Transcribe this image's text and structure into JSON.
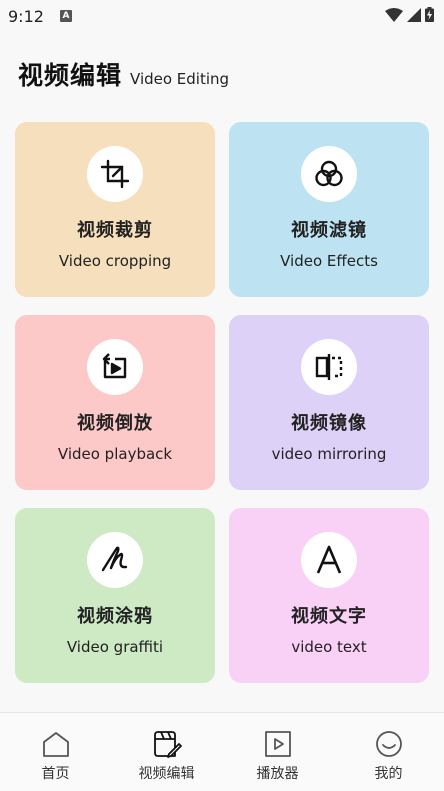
{
  "status": {
    "time": "9:12",
    "notif": "A"
  },
  "header": {
    "title": "视频编辑",
    "subtitle": "Video Editing"
  },
  "cards": [
    {
      "title": "视频裁剪",
      "subtitle": "Video cropping",
      "bg": "#f6dfbd",
      "icon": "crop-icon"
    },
    {
      "title": "视频滤镜",
      "subtitle": "Video Effects",
      "bg": "#bde3f3",
      "icon": "filter-icon"
    },
    {
      "title": "视频倒放",
      "subtitle": "Video playback",
      "bg": "#fdc8c8",
      "icon": "reverse-play-icon"
    },
    {
      "title": "视频镜像",
      "subtitle": "video mirroring",
      "bg": "#ddd1f7",
      "icon": "mirror-icon"
    },
    {
      "title": "视频涂鸦",
      "subtitle": "Video graffiti",
      "bg": "#cdeac5",
      "icon": "graffiti-icon"
    },
    {
      "title": "视频文字",
      "subtitle": "video text",
      "bg": "#f9d0f6",
      "icon": "text-icon"
    }
  ],
  "tabs": [
    {
      "label": "首页",
      "icon": "home-icon"
    },
    {
      "label": "视频编辑",
      "icon": "video-edit-icon"
    },
    {
      "label": "播放器",
      "icon": "player-icon"
    },
    {
      "label": "我的",
      "icon": "smile-icon"
    }
  ]
}
